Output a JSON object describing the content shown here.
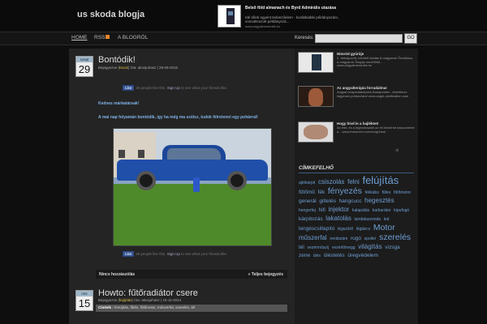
{
  "header": {
    "site_title": "us skoda blogja",
    "top_ad": {
      "title": "Belső föld almanach és Byrd Admirális utazása",
      "text": "Idé tőleb egyént tedvezőelem - korábbiabbi példányszám, vonzalmozott példányszá...",
      "url": "www.angyalmenedek.hu"
    }
  },
  "nav": {
    "home": "HOME",
    "rss": "RSS",
    "blog": "A BLOGRÓL",
    "search_label": "Keresés:",
    "search_value": "",
    "search_button": "GO"
  },
  "posts": [
    {
      "month": "szept",
      "day": "29",
      "title": "Bontódik!",
      "meta_prefix": "Bejegyezve (",
      "category": "Kocsi",
      "meta_suffix": ") írta: akosjuhasz | 29-09-2015",
      "fb_like": "Like",
      "fb_count": "26 people like this.",
      "fb_signup": "Sign Up",
      "fb_suffix": "to see what your friends like.",
      "greeting": "Kedves márkatársak!",
      "lead": "A mai nap folyamán bontódik, így ha még ma szólsz, tudok félretenni egy pohárral!",
      "comments": "Nincs hozzászólás",
      "full_post": "» Teljes bejegyzés"
    },
    {
      "month": "nov",
      "day": "15",
      "title": "Howto: fűtőradiátor csere",
      "meta_prefix": "Bejegyezve (",
      "category": "fejújítás",
      "meta_suffix": ") írta: akosjuhasz | 15-11-2014",
      "tags_label": "Címkék :",
      "tags": "fenújítás, fűtés, fűtőmotor, műszerfal, szerelés, tél"
    }
  ],
  "sidebar": {
    "ads": [
      {
        "title": "Nimród gyűrűje",
        "text": "2. átdolgozott, bővített kiadás A magyarok Ősvallása, a magyarok Ősapja mezőföldi... www.angyalmenedek.hu"
      },
      {
        "title": "Az angyalterápia forradalma!",
        "text": "Angyal terapeutaképzés Budapesten. Jelentkezz ingyenes próbaórára! www.angel-clarification.com"
      },
      {
        "title": "Hogy hívd le a hajléktet!",
        "text": "Az élet, és a legfontosabb az éli benlehet haszonlehet a... www.thesecret.com/hu/grinea/"
      }
    ],
    "ads_more": "⊕",
    "tag_heading": "CÍMKEFELHŐ",
    "tags": [
      {
        "t": "ajtókárpit",
        "s": 1
      },
      {
        "t": "csiszolás",
        "s": 3
      },
      {
        "t": "felni",
        "s": 3
      },
      {
        "t": "felújítás",
        "s": 5
      },
      {
        "t": "fűtőmű",
        "s": 2
      },
      {
        "t": "fék",
        "s": 2
      },
      {
        "t": "fényezés",
        "s": 4
      },
      {
        "t": "fékkábs",
        "s": 1
      },
      {
        "t": "fűtés",
        "s": 1
      },
      {
        "t": "fűtőmotor",
        "s": 1
      },
      {
        "t": "generál",
        "s": 2
      },
      {
        "t": "gittelés",
        "s": 2
      },
      {
        "t": "hangcucc",
        "s": 2
      },
      {
        "t": "hegesztés",
        "s": 3
      },
      {
        "t": "hengerfej",
        "s": 1
      },
      {
        "t": "hifi",
        "s": 2
      },
      {
        "t": "injektor",
        "s": 3
      },
      {
        "t": "kalapálás",
        "s": 1
      },
      {
        "t": "karburátor",
        "s": 1
      },
      {
        "t": "kipufogó",
        "s": 1
      },
      {
        "t": "kárpitozás",
        "s": 2
      },
      {
        "t": "lakatolás",
        "s": 3
      },
      {
        "t": "lambdaszonda",
        "s": 1
      },
      {
        "t": "led",
        "s": 1
      },
      {
        "t": "lengéscsillapító",
        "s": 2
      },
      {
        "t": "légszűrő",
        "s": 1
      },
      {
        "t": "légtárcs",
        "s": 1
      },
      {
        "t": "Motor",
        "s": 4
      },
      {
        "t": "műszerfal",
        "s": 3
      },
      {
        "t": "rendszám",
        "s": 1
      },
      {
        "t": "rugó",
        "s": 2
      },
      {
        "t": "spoiler",
        "s": 1
      },
      {
        "t": "szerelés",
        "s": 4
      },
      {
        "t": "tél",
        "s": 2
      },
      {
        "t": "vezérműszíj",
        "s": 1
      },
      {
        "t": "vezérlőmegg",
        "s": 1
      },
      {
        "t": "világítás",
        "s": 3
      },
      {
        "t": "vizsga",
        "s": 2
      },
      {
        "t": "zene",
        "s": 2
      },
      {
        "t": "ülés",
        "s": 1
      },
      {
        "t": "üléstetés",
        "s": 2
      },
      {
        "t": "üregvédelem",
        "s": 2
      }
    ]
  }
}
